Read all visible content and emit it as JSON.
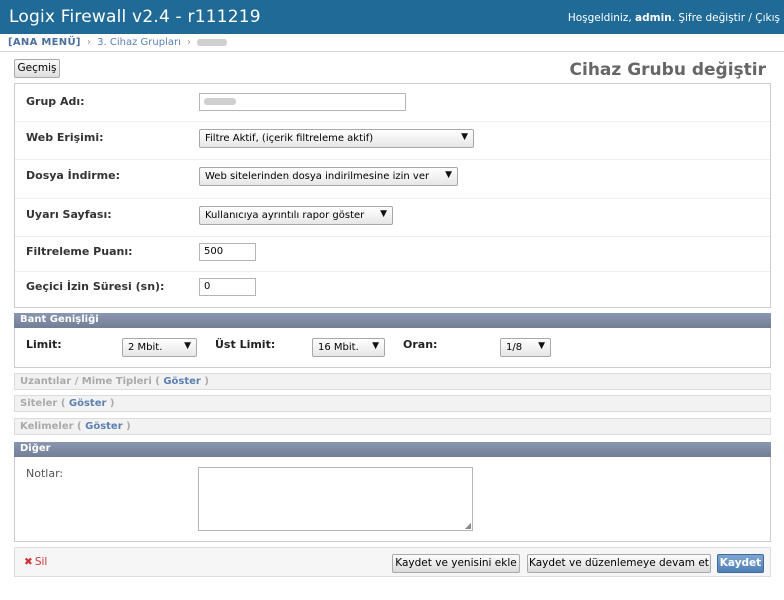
{
  "header": {
    "app_title": "Logix Firewall v2.4 - r111219",
    "welcome": "Hoşgeldiniz,",
    "username": "admin",
    "change_password": "Şifre değiştir",
    "separator": "/",
    "logout": "Çıkış"
  },
  "breadcrumb": {
    "home": "[ANA MENÜ]",
    "sep": "›",
    "section": "3. Cihaz Grupları"
  },
  "toolbar": {
    "history": "Geçmiş"
  },
  "page": {
    "title": "Cihaz Grubu değiştir"
  },
  "form": {
    "group_name": {
      "label": "Grup Adı:",
      "value": ""
    },
    "web_access": {
      "label": "Web Erişimi:",
      "value": "Filtre Aktif, (içerik filtreleme aktif)"
    },
    "file_download": {
      "label": "Dosya İndirme:",
      "value": "Web sitelerinden dosya indirilmesine izin ver"
    },
    "warning_page": {
      "label": "Uyarı Sayfası:",
      "value": "Kullanıcıya ayrıntılı rapor göster"
    },
    "filter_score": {
      "label": "Filtreleme Puanı:",
      "value": "500"
    },
    "temp_permission": {
      "label": "Geçici İzin Süresi (sn):",
      "value": "0"
    }
  },
  "bandwidth": {
    "header": "Bant Genişliği",
    "limit_label": "Limit:",
    "limit_value": "2 Mbit.",
    "upper_label": "Üst Limit:",
    "upper_value": "16 Mbit.",
    "ratio_label": "Oran:",
    "ratio_value": "1/8"
  },
  "collapsed_sections": {
    "extensions": "Uzantılar / Mime Tipleri",
    "sites": "Siteler",
    "keywords": "Kelimeler",
    "show": "Göster"
  },
  "other": {
    "header": "Diğer",
    "notes_label": "Notlar:",
    "notes_value": ""
  },
  "actions": {
    "delete": "Sil",
    "save_add_new": "Kaydet ve yenisini ekle",
    "save_continue": "Kaydet ve düzenlemeye devam et",
    "save": "Kaydet"
  },
  "colors": {
    "header_bg": "#1f6a96",
    "module_header_bg": "#7a86a0",
    "link": "#5b80b2",
    "delete": "#cc3434"
  }
}
